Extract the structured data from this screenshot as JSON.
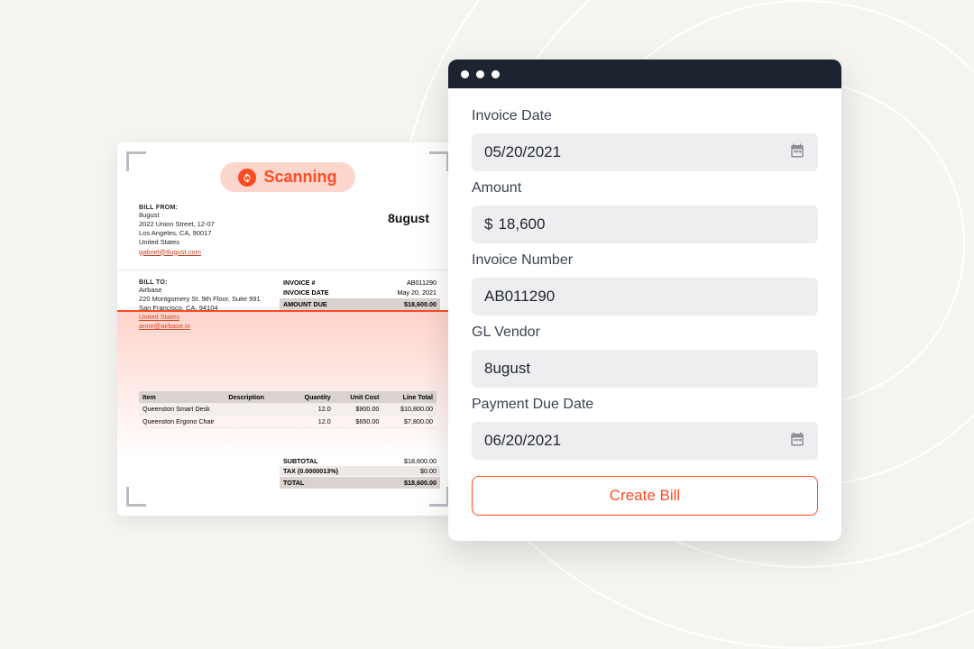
{
  "scanning": {
    "label": "Scanning"
  },
  "invoice": {
    "billFromLabel": "BILL FROM:",
    "from": {
      "name": "8ugust",
      "street": "2022 Union Street, 12-07",
      "cityLine": "Los Angeles, CA, 90017",
      "country": "United States",
      "email": "gabriel@8ugust.com"
    },
    "vendorLogo": "8ugust",
    "billToLabel": "BILL TO:",
    "to": {
      "name": "Airbase",
      "street": "220 Montgomery St. 9th Floor, Suite 991",
      "cityLine": "San Francisco, CA, 94104",
      "country": "United States",
      "email": "anne@airbase.io"
    },
    "meta": {
      "invoiceNumLabel": "INVOICE #",
      "invoiceNum": "AB011290",
      "invoiceDateLabel": "INVOICE DATE",
      "invoiceDate": "May 20, 2021",
      "amountDueLabel": "AMOUNT DUE",
      "amountDue": "$18,600.00"
    },
    "lineHeader": {
      "item": "Item",
      "desc": "Description",
      "qty": "Quantity",
      "unit": "Unit Cost",
      "total": "Line Total"
    },
    "lines": [
      {
        "item": "Queenston Smart Desk",
        "desc": "",
        "qty": "12.0",
        "unit": "$900.00",
        "total": "$10,800.00"
      },
      {
        "item": "Queenston Ergono Chair",
        "desc": "",
        "qty": "12.0",
        "unit": "$650.00",
        "total": "$7,800.00"
      }
    ],
    "totals": {
      "subtotalLabel": "SUBTOTAL",
      "subtotal": "$18,600.00",
      "taxLabel": "TAX (0.0000013%)",
      "tax": "$0.00",
      "totalLabel": "TOTAL",
      "total": "$18,600.00"
    }
  },
  "form": {
    "invoiceDateLabel": "Invoice Date",
    "invoiceDate": "05/20/2021",
    "amountLabel": "Amount",
    "amountPrefix": "$",
    "amount": "18,600",
    "invoiceNumberLabel": "Invoice Number",
    "invoiceNumber": "AB011290",
    "glVendorLabel": "GL Vendor",
    "glVendor": "8ugust",
    "paymentDueLabel": "Payment Due Date",
    "paymentDue": "06/20/2021",
    "createBill": "Create Bill"
  }
}
